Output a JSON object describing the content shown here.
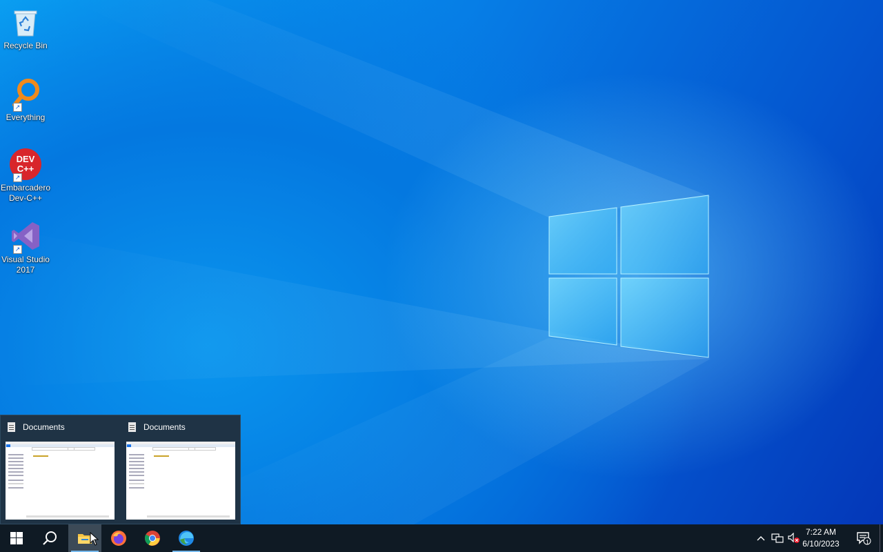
{
  "desktop": {
    "icons": [
      {
        "name": "recycle-bin-icon",
        "label": "Recycle Bin"
      },
      {
        "name": "everything-icon",
        "label": "Everything"
      },
      {
        "name": "devcpp-icon",
        "label": "Embarcadero\nDev-C++",
        "logo_text": "DEV C++"
      },
      {
        "name": "visual-studio-icon",
        "label": "Visual Studio\n2017"
      }
    ]
  },
  "thumbnails": [
    {
      "title": "Documents"
    },
    {
      "title": "Documents"
    }
  ],
  "taskbar": {
    "start": "windows-start-icon",
    "search": "search-icon",
    "apps": [
      "file-explorer-icon",
      "firefox-icon",
      "chrome-icon",
      "edge-icon"
    ],
    "active_app": "file-explorer-icon"
  },
  "tray": {
    "time": "7:22 AM",
    "date": "6/10/2023",
    "notification_count": "1"
  },
  "colors": {
    "taskbar": "#0f1a24",
    "thumb_popup": "#1f3345",
    "accent": "#76b9ed"
  }
}
